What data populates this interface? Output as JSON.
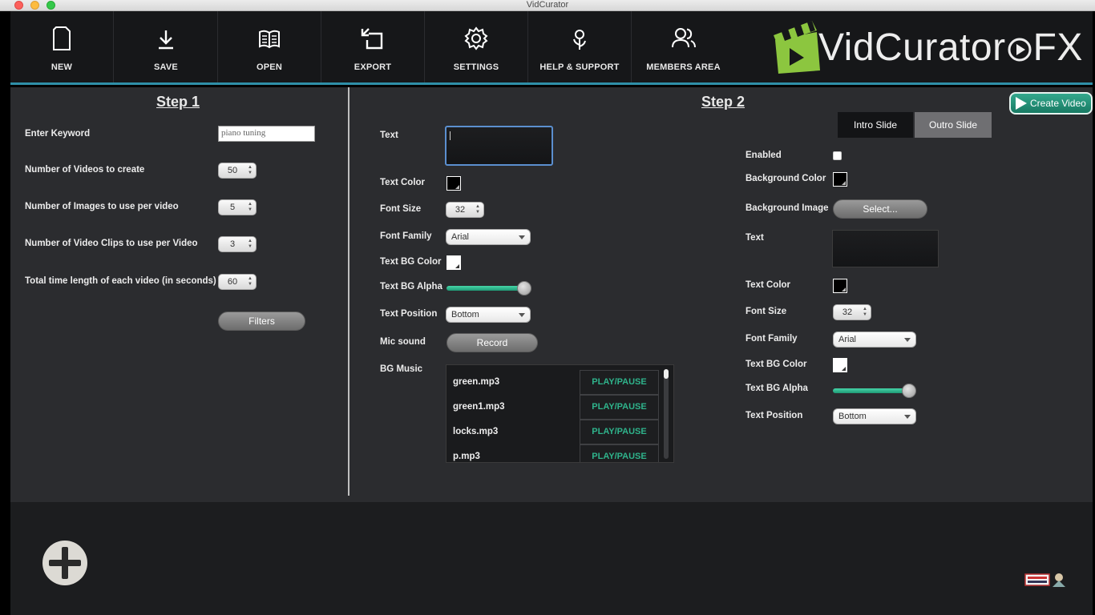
{
  "window": {
    "title": "VidCurator"
  },
  "toolbar": {
    "buttons": [
      {
        "label": "NEW",
        "icon": "new-file-icon"
      },
      {
        "label": "SAVE",
        "icon": "download-icon"
      },
      {
        "label": "OPEN",
        "icon": "book-icon"
      },
      {
        "label": "EXPORT",
        "icon": "export-icon"
      },
      {
        "label": "SETTINGS",
        "icon": "gear-icon"
      },
      {
        "label": "HELP & SUPPORT",
        "icon": "flower-icon"
      },
      {
        "label": "MEMBERS AREA",
        "icon": "users-icon"
      }
    ],
    "logo_text": "VidCurator▶FX",
    "logo_text_a": "VidCurator",
    "logo_text_b": "FX"
  },
  "step1": {
    "title": "Step 1",
    "keyword_label": "Enter Keyword",
    "keyword_value": "piano tuning",
    "videos_label": "Number of Videos to create",
    "videos_value": "50",
    "images_label": "Number of Images to use per video",
    "images_value": "5",
    "clips_label": "Number of Video Clips to use per Video",
    "clips_value": "3",
    "time_label": "Total time length of each video (in seconds)",
    "time_value": "60",
    "filters_button": "Filters"
  },
  "step2": {
    "title": "Step 2",
    "create_video": "Create Video",
    "left": {
      "text_label": "Text",
      "text_color_label": "Text Color",
      "font_size_label": "Font Size",
      "font_size_value": "32",
      "font_family_label": "Font Family",
      "font_family_value": "Arial",
      "text_bg_color_label": "Text BG Color",
      "text_bg_alpha_label": "Text BG Alpha",
      "text_bg_alpha_value": 1.0,
      "text_position_label": "Text Position",
      "text_position_value": "Bottom",
      "mic_label": "Mic sound",
      "record_button": "Record",
      "bg_music_label": "BG Music",
      "music": [
        {
          "name": "green.mp3",
          "action": "PLAY/PAUSE"
        },
        {
          "name": "green1.mp3",
          "action": "PLAY/PAUSE"
        },
        {
          "name": "locks.mp3",
          "action": "PLAY/PAUSE"
        },
        {
          "name": "p.mp3",
          "action": "PLAY/PAUSE"
        }
      ]
    },
    "right": {
      "tabs": [
        "Intro Slide",
        "Outro Slide"
      ],
      "active_tab": "Outro Slide",
      "enabled_label": "Enabled",
      "bg_color_label": "Background Color",
      "bg_image_label": "Background Image",
      "select_button": "Select...",
      "text_label": "Text",
      "text_color_label": "Text Color",
      "font_size_label": "Font Size",
      "font_size_value": "32",
      "font_family_label": "Font Family",
      "font_family_value": "Arial",
      "text_bg_color_label": "Text BG Color",
      "text_bg_alpha_label": "Text BG Alpha",
      "text_bg_alpha_value": 1.0,
      "text_position_label": "Text Position",
      "text_position_value": "Bottom"
    }
  },
  "colors": {
    "accent": "#2f8fa8",
    "play_green": "#2fb38b",
    "slider_green": "#2fbf92",
    "logo_green": "#8cc63f"
  }
}
